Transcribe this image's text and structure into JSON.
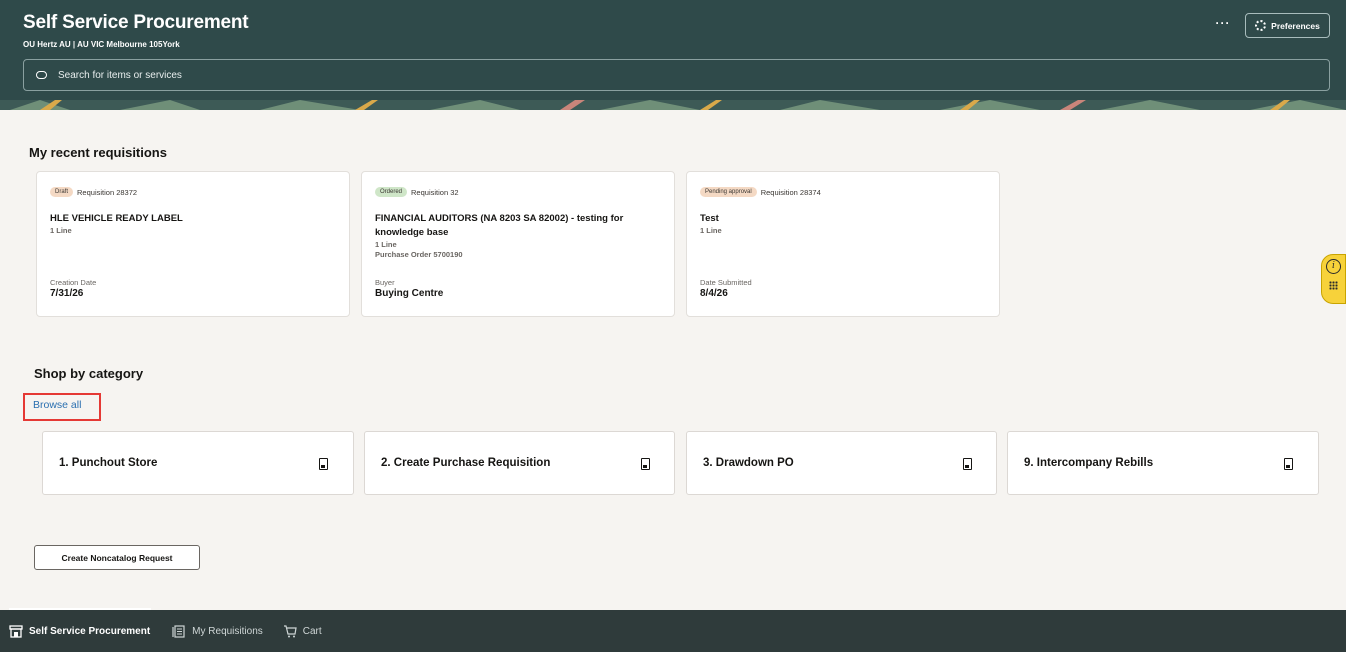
{
  "header": {
    "title": "Self Service Procurement",
    "subtitle": "OU Hertz AU | AU VIC Melbourne 105York",
    "more_label": "···",
    "preferences_label": "Preferences",
    "search_placeholder": "Search for items or services",
    "background_color": "#2f4a4a"
  },
  "recent": {
    "section_title": "My recent requisitions",
    "cards": [
      {
        "status": "Draft",
        "requisition": "Requisition 28372",
        "title": "HLE VEHICLE READY LABEL",
        "lines": "1 Line",
        "extra": "",
        "meta_label": "Creation Date",
        "meta_value": "7/31/26"
      },
      {
        "status": "Ordered",
        "requisition": "Requisition 32",
        "title": "FINANCIAL AUDITORS (NA 8203 SA 82002) - testing for knowledge base",
        "lines": "1 Line",
        "extra": "Purchase Order 5700190",
        "meta_label": "Buyer",
        "meta_value": "Buying Centre"
      },
      {
        "status": "Pending approval",
        "requisition": "Requisition 28374",
        "title": "Test",
        "lines": "1 Line",
        "extra": "",
        "meta_label": "Date Submitted",
        "meta_value": "8/4/26"
      }
    ]
  },
  "category": {
    "section_title": "Shop by category",
    "browse_all": "Browse all",
    "items": [
      {
        "label": "1. Punchout Store",
        "icon": "document-icon"
      },
      {
        "label": "2. Create Purchase Requisition",
        "icon": "document-icon"
      },
      {
        "label": "3. Drawdown PO",
        "icon": "document-icon"
      },
      {
        "label": "9. Intercompany Rebills",
        "icon": "document-icon"
      }
    ]
  },
  "noncatalog_button": "Create Noncatalog Request",
  "bottom_nav": {
    "items": [
      {
        "label": "Self Service Procurement",
        "icon": "store-icon",
        "active": true
      },
      {
        "label": "My Requisitions",
        "icon": "requisitions-icon",
        "active": false
      },
      {
        "label": "Cart",
        "icon": "cart-icon",
        "active": false
      }
    ]
  },
  "help_widget": {
    "icon": "info-icon",
    "accent": "#f7d23a"
  }
}
